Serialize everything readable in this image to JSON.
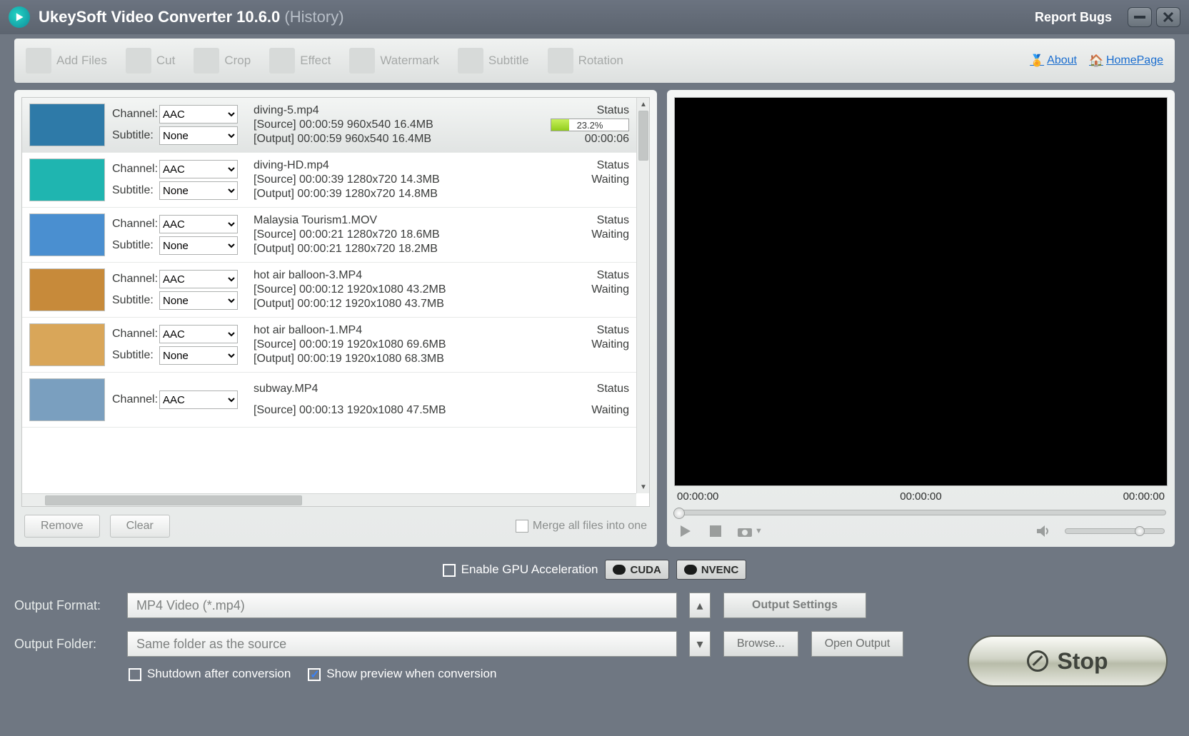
{
  "title": {
    "app": "UkeySoft Video Converter 10.6.0",
    "hist": "(History)"
  },
  "report_bugs": "Report Bugs",
  "toolbar": [
    {
      "name": "add-files",
      "label": "Add Files"
    },
    {
      "name": "cut",
      "label": "Cut"
    },
    {
      "name": "crop",
      "label": "Crop"
    },
    {
      "name": "effect",
      "label": "Effect"
    },
    {
      "name": "watermark",
      "label": "Watermark"
    },
    {
      "name": "subtitle",
      "label": "Subtitle"
    },
    {
      "name": "rotation",
      "label": "Rotation"
    }
  ],
  "links": {
    "about": "About",
    "home": "HomePage"
  },
  "headers": {
    "channel": "Channel:",
    "subtitle": "Subtitle:",
    "status": "Status"
  },
  "files": [
    {
      "channel": "AAC",
      "subtitle": "None",
      "name": "diving-5.mp4",
      "src": "[Source]  00:00:59  960x540  16.4MB",
      "out": "[Output]  00:00:59  960x540  16.4MB",
      "status": "progress",
      "progress": "23.2%",
      "progressW": "23.2%",
      "eta": "00:00:06",
      "thumb": "#2e7aa8",
      "sel": true
    },
    {
      "channel": "AAC",
      "subtitle": "None",
      "name": "diving-HD.mp4",
      "src": "[Source]  00:00:39  1280x720  14.3MB",
      "out": "[Output]  00:00:39  1280x720  14.8MB",
      "status": "Waiting",
      "thumb": "#1fb5b0"
    },
    {
      "channel": "AAC",
      "subtitle": "None",
      "name": "Malaysia Tourism1.MOV",
      "src": "[Source]  00:00:21  1280x720  18.6MB",
      "out": "[Output]  00:00:21  1280x720  18.2MB",
      "status": "Waiting",
      "thumb": "#4a8fd0"
    },
    {
      "channel": "AAC",
      "subtitle": "None",
      "name": "hot air balloon-3.MP4",
      "src": "[Source]  00:00:12  1920x1080  43.2MB",
      "out": "[Output]  00:00:12  1920x1080  43.7MB",
      "status": "Waiting",
      "thumb": "#c78a3a"
    },
    {
      "channel": "AAC",
      "subtitle": "None",
      "name": "hot air balloon-1.MP4",
      "src": "[Source]  00:00:19  1920x1080  69.6MB",
      "out": "[Output]  00:00:19  1920x1080  68.3MB",
      "status": "Waiting",
      "thumb": "#d9a659"
    },
    {
      "channel": "AAC",
      "subtitle": "None",
      "name": "subway.MP4",
      "src": "[Source]  00:00:13  1920x1080  47.5MB",
      "out": "",
      "status": "Waiting",
      "thumb": "#7a9fbf",
      "partial": true
    }
  ],
  "listfoot": {
    "remove": "Remove",
    "clear": "Clear",
    "merge": "Merge all files into one"
  },
  "preview": {
    "t1": "00:00:00",
    "t2": "00:00:00",
    "t3": "00:00:00"
  },
  "gpu": {
    "enable": "Enable GPU Acceleration",
    "cuda": "CUDA",
    "nvenc": "NVENC"
  },
  "out": {
    "fmt_label": "Output Format:",
    "fmt": "MP4 Video (*.mp4)",
    "settings": "Output Settings",
    "fld_label": "Output Folder:",
    "fld": "Same folder as the source",
    "browse": "Browse...",
    "open": "Open Output",
    "stop": "Stop"
  },
  "opts": {
    "shutdown": "Shutdown after conversion",
    "preview": "Show preview when conversion"
  }
}
